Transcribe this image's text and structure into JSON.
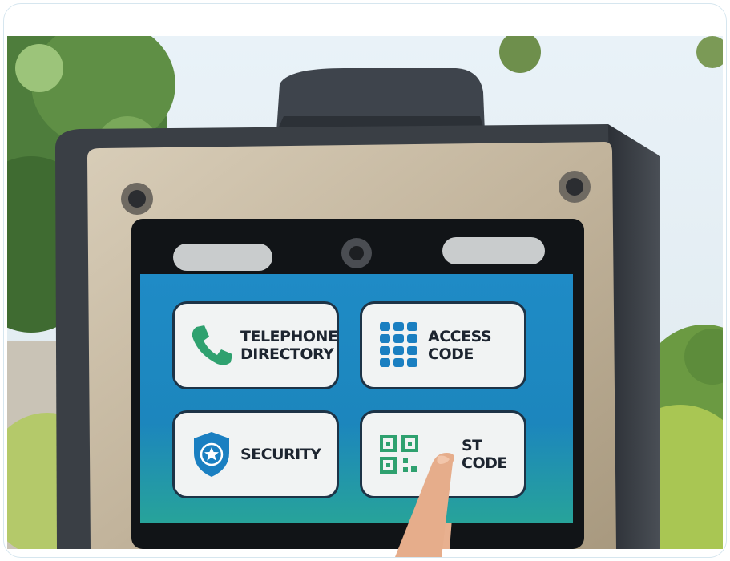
{
  "photo": {
    "description_icons": [
      "phone-icon",
      "keypad-icon",
      "shield-star-icon",
      "qr-code-icon"
    ],
    "colors": {
      "screen_blue": "#1f8bc6",
      "screen_teal": "#27a39a",
      "icon_blue": "#1a7fc1",
      "icon_green": "#2fa16f"
    }
  },
  "screen": {
    "tiles": [
      {
        "line1": "TELEPHONE",
        "line2": "DIRECTORY"
      },
      {
        "line1": "ACCESS",
        "line2": "CODE"
      },
      {
        "line1": "SECURITY",
        "line2": ""
      },
      {
        "line1": "ST",
        "line2": "CODE"
      }
    ]
  }
}
